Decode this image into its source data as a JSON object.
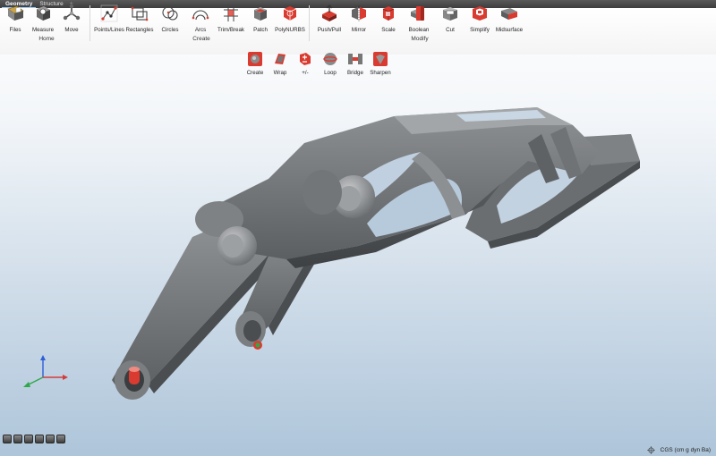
{
  "tabs": [
    {
      "label": "Geometry",
      "active": true
    },
    {
      "label": "Structure",
      "active": false
    }
  ],
  "tab_add": "+",
  "ribbon": {
    "groups": [
      {
        "label": "Home"
      },
      {
        "label": "Create"
      },
      {
        "label": "Modify"
      }
    ],
    "main_tools": [
      {
        "label": "Files",
        "icon": "files-icon"
      },
      {
        "label": "Measure",
        "icon": "measure-icon"
      },
      {
        "label": "Move",
        "icon": "move-icon"
      },
      {
        "label": "Points/Lines",
        "icon": "points-lines-icon"
      },
      {
        "label": "Rectangles",
        "icon": "rectangles-icon"
      },
      {
        "label": "Circles",
        "icon": "circles-icon"
      },
      {
        "label": "Arcs",
        "icon": "arcs-icon"
      },
      {
        "label": "Trim/Break",
        "icon": "trim-break-icon"
      },
      {
        "label": "Patch",
        "icon": "patch-icon"
      },
      {
        "label": "PolyNURBS",
        "icon": "polynurbs-icon"
      },
      {
        "label": "Push/Pull",
        "icon": "push-pull-icon"
      },
      {
        "label": "Mirror",
        "icon": "mirror-icon"
      },
      {
        "label": "Scale",
        "icon": "scale-icon"
      },
      {
        "label": "Boolean",
        "icon": "boolean-icon"
      },
      {
        "label": "Cut",
        "icon": "cut-icon"
      },
      {
        "label": "Simplify",
        "icon": "simplify-icon"
      },
      {
        "label": "Midsurface",
        "icon": "midsurface-icon"
      }
    ],
    "sub_tools": [
      {
        "label": "Create",
        "icon": "create-icon"
      },
      {
        "label": "Wrap",
        "icon": "wrap-icon"
      },
      {
        "label": "+/-",
        "icon": "plus-minus-icon"
      },
      {
        "label": "Loop",
        "icon": "loop-icon"
      },
      {
        "label": "Bridge",
        "icon": "bridge-icon"
      },
      {
        "label": "Sharpen",
        "icon": "sharpen-icon"
      }
    ]
  },
  "bottom_tools": [
    "view-cube-icon",
    "section-icon",
    "display-icon",
    "fit-view-icon",
    "zoom-icon",
    "rotate-icon"
  ],
  "status": {
    "units": "CGS (cm g dyn Ba)"
  },
  "colors": {
    "tabbar": "#3d3d3d",
    "accent_red": "#d93b30",
    "model_gray": "#6f7275",
    "axis_x": "#d23c3c",
    "axis_y": "#2fa84a",
    "axis_z": "#2e5fd6"
  }
}
